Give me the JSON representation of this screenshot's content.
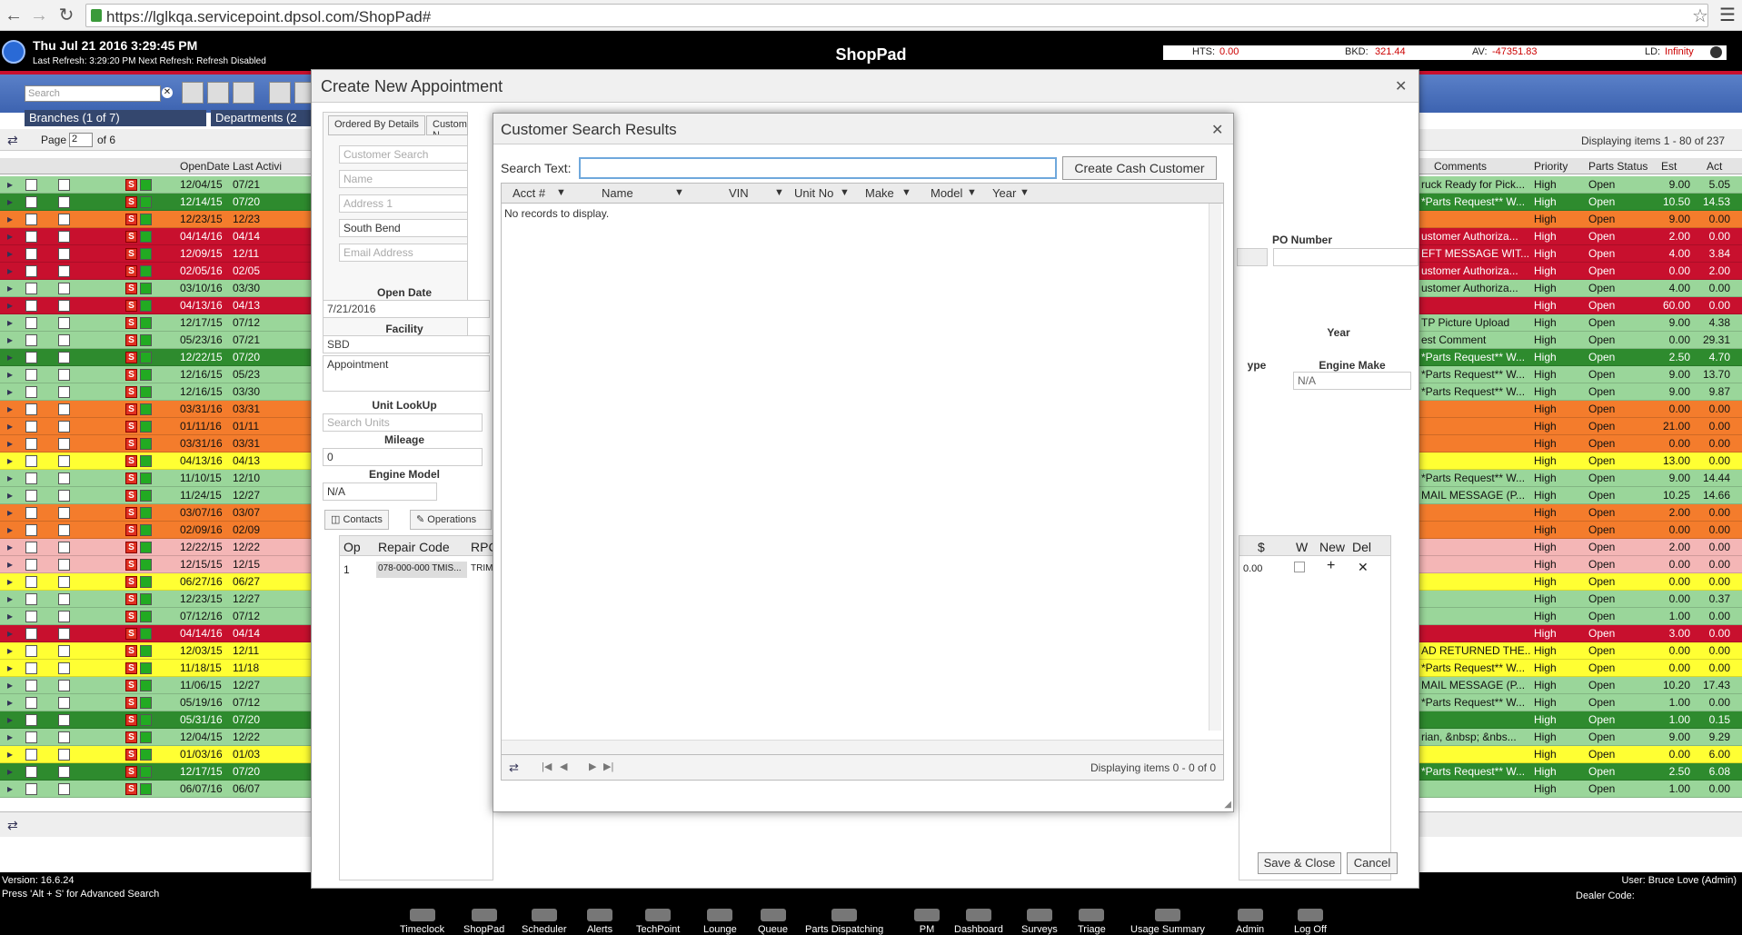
{
  "browser": {
    "url": "https://lglkqa.servicepoint.dpsol.com/ShopPad#"
  },
  "header": {
    "datetime": "Thu Jul 21 2016 3:29:45 PM",
    "refresh": "Last Refresh: 3:29:20 PM   Next Refresh: Refresh Disabled",
    "title": "ShopPad",
    "stats": [
      {
        "label": "HTS:",
        "value": "0.00"
      },
      {
        "label": "BKD:",
        "value": "321.44"
      },
      {
        "label": "AV:",
        "value": "-47351.83"
      },
      {
        "label": "LD:",
        "value": "Infinity"
      }
    ]
  },
  "toolbar": {
    "search_placeholder": "Search",
    "branches": "Branches (1 of 7)",
    "departments": "Departments (2"
  },
  "pager": {
    "label": "Page",
    "page": "2",
    "of": "of 6",
    "displaying": "Displaying items 1 - 80 of 237"
  },
  "grid": {
    "headers_left": [
      "OpenDate",
      "Last Activi"
    ],
    "headers_right": [
      "Comments",
      "Priority",
      "Parts Status",
      "Est",
      "Act"
    ],
    "rows": [
      {
        "open": "12/04/15",
        "last": "07/21",
        "comment": "ruck Ready for Pick...",
        "priority": "High",
        "status": "Open",
        "est": "9.00",
        "act": "5.05",
        "color": "#9ad69a"
      },
      {
        "open": "12/14/15",
        "last": "07/20",
        "comment": "*Parts Request** W...",
        "priority": "High",
        "status": "Open",
        "est": "10.50",
        "act": "14.53",
        "color": "#2e8b2e"
      },
      {
        "open": "12/23/15",
        "last": "12/23",
        "comment": "",
        "priority": "High",
        "status": "Open",
        "est": "9.00",
        "act": "0.00",
        "color": "#f47c2c"
      },
      {
        "open": "04/14/16",
        "last": "04/14",
        "comment": "ustomer Authoriza...",
        "priority": "High",
        "status": "Open",
        "est": "2.00",
        "act": "0.00",
        "color": "#c8102e"
      },
      {
        "open": "12/09/15",
        "last": "12/11",
        "comment": "EFT MESSAGE WIT...",
        "priority": "High",
        "status": "Open",
        "est": "4.00",
        "act": "3.84",
        "color": "#c8102e"
      },
      {
        "open": "02/05/16",
        "last": "02/05",
        "comment": "ustomer Authoriza...",
        "priority": "High",
        "status": "Open",
        "est": "0.00",
        "act": "2.00",
        "color": "#c8102e"
      },
      {
        "open": "03/10/16",
        "last": "03/30",
        "comment": "ustomer Authoriza...",
        "priority": "High",
        "status": "Open",
        "est": "4.00",
        "act": "0.00",
        "color": "#9ad69a"
      },
      {
        "open": "04/13/16",
        "last": "04/13",
        "comment": "",
        "priority": "High",
        "status": "Open",
        "est": "60.00",
        "act": "0.00",
        "color": "#c8102e"
      },
      {
        "open": "12/17/15",
        "last": "07/12",
        "comment": "TP Picture Upload",
        "priority": "High",
        "status": "Open",
        "est": "9.00",
        "act": "4.38",
        "color": "#9ad69a"
      },
      {
        "open": "05/23/16",
        "last": "07/21",
        "comment": "est Comment",
        "priority": "High",
        "status": "Open",
        "est": "0.00",
        "act": "29.31",
        "color": "#9ad69a"
      },
      {
        "open": "12/22/15",
        "last": "07/20",
        "comment": "*Parts Request** W...",
        "priority": "High",
        "status": "Open",
        "est": "2.50",
        "act": "4.70",
        "color": "#2e8b2e"
      },
      {
        "open": "12/16/15",
        "last": "05/23",
        "comment": "*Parts Request** W...",
        "priority": "High",
        "status": "Open",
        "est": "9.00",
        "act": "13.70",
        "color": "#9ad69a"
      },
      {
        "open": "12/16/15",
        "last": "03/30",
        "comment": "*Parts Request** W...",
        "priority": "High",
        "status": "Open",
        "est": "9.00",
        "act": "9.87",
        "color": "#9ad69a"
      },
      {
        "open": "03/31/16",
        "last": "03/31",
        "comment": "",
        "priority": "High",
        "status": "Open",
        "est": "0.00",
        "act": "0.00",
        "color": "#f47c2c"
      },
      {
        "open": "01/11/16",
        "last": "01/11",
        "comment": "",
        "priority": "High",
        "status": "Open",
        "est": "21.00",
        "act": "0.00",
        "color": "#f47c2c"
      },
      {
        "open": "03/31/16",
        "last": "03/31",
        "comment": "",
        "priority": "High",
        "status": "Open",
        "est": "0.00",
        "act": "0.00",
        "color": "#f47c2c"
      },
      {
        "open": "04/13/16",
        "last": "04/13",
        "comment": "",
        "priority": "High",
        "status": "Open",
        "est": "13.00",
        "act": "0.00",
        "color": "#ffff33"
      },
      {
        "open": "11/10/15",
        "last": "12/10",
        "comment": "*Parts Request** W...",
        "priority": "High",
        "status": "Open",
        "est": "9.00",
        "act": "14.44",
        "color": "#9ad69a"
      },
      {
        "open": "11/24/15",
        "last": "12/27",
        "comment": "MAIL MESSAGE (P...",
        "priority": "High",
        "status": "Open",
        "est": "10.25",
        "act": "14.66",
        "color": "#9ad69a"
      },
      {
        "open": "03/07/16",
        "last": "03/07",
        "comment": "",
        "priority": "High",
        "status": "Open",
        "est": "2.00",
        "act": "0.00",
        "color": "#f47c2c"
      },
      {
        "open": "02/09/16",
        "last": "02/09",
        "comment": "",
        "priority": "High",
        "status": "Open",
        "est": "0.00",
        "act": "0.00",
        "color": "#f47c2c"
      },
      {
        "open": "12/22/15",
        "last": "12/22",
        "comment": "",
        "priority": "High",
        "status": "Open",
        "est": "2.00",
        "act": "0.00",
        "color": "#f4b6b6"
      },
      {
        "open": "12/15/15",
        "last": "12/15",
        "comment": "",
        "priority": "High",
        "status": "Open",
        "est": "0.00",
        "act": "0.00",
        "color": "#f4b6b6"
      },
      {
        "open": "06/27/16",
        "last": "06/27",
        "comment": "",
        "priority": "High",
        "status": "Open",
        "est": "0.00",
        "act": "0.00",
        "color": "#ffff33"
      },
      {
        "open": "12/23/15",
        "last": "12/27",
        "comment": "",
        "priority": "High",
        "status": "Open",
        "est": "0.00",
        "act": "0.37",
        "color": "#9ad69a"
      },
      {
        "open": "07/12/16",
        "last": "07/12",
        "comment": "",
        "priority": "High",
        "status": "Open",
        "est": "1.00",
        "act": "0.00",
        "color": "#9ad69a"
      },
      {
        "open": "04/14/16",
        "last": "04/14",
        "comment": "",
        "priority": "High",
        "status": "Open",
        "est": "3.00",
        "act": "0.00",
        "color": "#c8102e"
      },
      {
        "open": "12/03/15",
        "last": "12/11",
        "comment": "AD RETURNED THE...",
        "priority": "High",
        "status": "Open",
        "est": "0.00",
        "act": "0.00",
        "color": "#ffff33"
      },
      {
        "open": "11/18/15",
        "last": "11/18",
        "comment": "*Parts Request** W...",
        "priority": "High",
        "status": "Open",
        "est": "0.00",
        "act": "0.00",
        "color": "#ffff33"
      },
      {
        "open": "11/06/15",
        "last": "12/27",
        "comment": "MAIL MESSAGE (P...",
        "priority": "High",
        "status": "Open",
        "est": "10.20",
        "act": "17.43",
        "color": "#9ad69a"
      },
      {
        "open": "05/19/16",
        "last": "07/12",
        "comment": "*Parts Request** W...",
        "priority": "High",
        "status": "Open",
        "est": "1.00",
        "act": "0.00",
        "color": "#9ad69a"
      },
      {
        "open": "05/31/16",
        "last": "07/20",
        "comment": "",
        "priority": "High",
        "status": "Open",
        "est": "1.00",
        "act": "0.15",
        "color": "#2e8b2e"
      },
      {
        "open": "12/04/15",
        "last": "12/22",
        "comment": "rian, &nbsp; &nbs...",
        "priority": "High",
        "status": "Open",
        "est": "9.00",
        "act": "9.29",
        "color": "#9ad69a"
      },
      {
        "open": "01/03/16",
        "last": "01/03",
        "comment": "",
        "priority": "High",
        "status": "Open",
        "est": "0.00",
        "act": "6.00",
        "color": "#ffff33"
      },
      {
        "open": "12/17/15",
        "last": "07/20",
        "comment": "*Parts Request** W...",
        "priority": "High",
        "status": "Open",
        "est": "2.50",
        "act": "6.08",
        "color": "#2e8b2e"
      },
      {
        "open": "06/07/16",
        "last": "06/07",
        "comment": "",
        "priority": "High",
        "status": "Open",
        "est": "1.00",
        "act": "0.00",
        "color": "#9ad69a"
      }
    ]
  },
  "footer": {
    "version": "Version: 16.6.24",
    "hint": "Press 'Alt + S' for Advanced Search",
    "user": "User: Bruce Love (Admin)",
    "dealer": "Dealer Code:",
    "nav": [
      "Timeclock",
      "ShopPad",
      "Scheduler",
      "Alerts",
      "TechPoint",
      "Lounge",
      "Queue",
      "Parts Dispatching",
      "PM",
      "Dashboard",
      "Surveys",
      "Triage",
      "Usage Summary",
      "Admin",
      "Log Off"
    ]
  },
  "modal": {
    "title": "Create New Appointment",
    "tabs": [
      "Ordered By Details",
      "Customer N"
    ],
    "customer_search_placeholder": "Customer Search",
    "name_placeholder": "Name",
    "address_placeholder": "Address 1",
    "city": "South Bend",
    "email_placeholder": "Email Address",
    "open_date_label": "Open Date",
    "open_date": "7/21/2016",
    "facility_label": "Facility",
    "facility": "SBD",
    "appointment": "Appointment",
    "po_label": "PO Number",
    "unit_lookup_label": "Unit LookUp",
    "unit_search_placeholder": "Search Units",
    "mileage_label": "Mileage",
    "mileage": "0",
    "engine_model_label": "Engine Model",
    "engine_model": "N/A",
    "year_label": "Year",
    "type_label": "ype",
    "engine_make_label": "Engine Make",
    "engine_make": "N/A",
    "contacts_tab": "Contacts",
    "operations_tab": "Operations",
    "ops_headers": [
      "Op",
      "Repair Code",
      "RPC"
    ],
    "ops_row": {
      "op": "1",
      "code": "078-000-000 TMIS...",
      "rpc": "TRIM"
    },
    "ops_right_headers": [
      "$",
      "W",
      "New",
      "Del"
    ],
    "ops_amount": "0.00",
    "save_close": "Save & Close",
    "cancel": "Cancel"
  },
  "search_dialog": {
    "title": "Customer Search Results",
    "search_label": "Search Text:",
    "search_value": "",
    "create_cash": "Create Cash Customer",
    "columns": [
      "Acct #",
      "Name",
      "VIN",
      "Unit No",
      "Make",
      "Model",
      "Year"
    ],
    "no_records": "No records to display.",
    "displaying": "Displaying items 0 - 0 of 0"
  }
}
